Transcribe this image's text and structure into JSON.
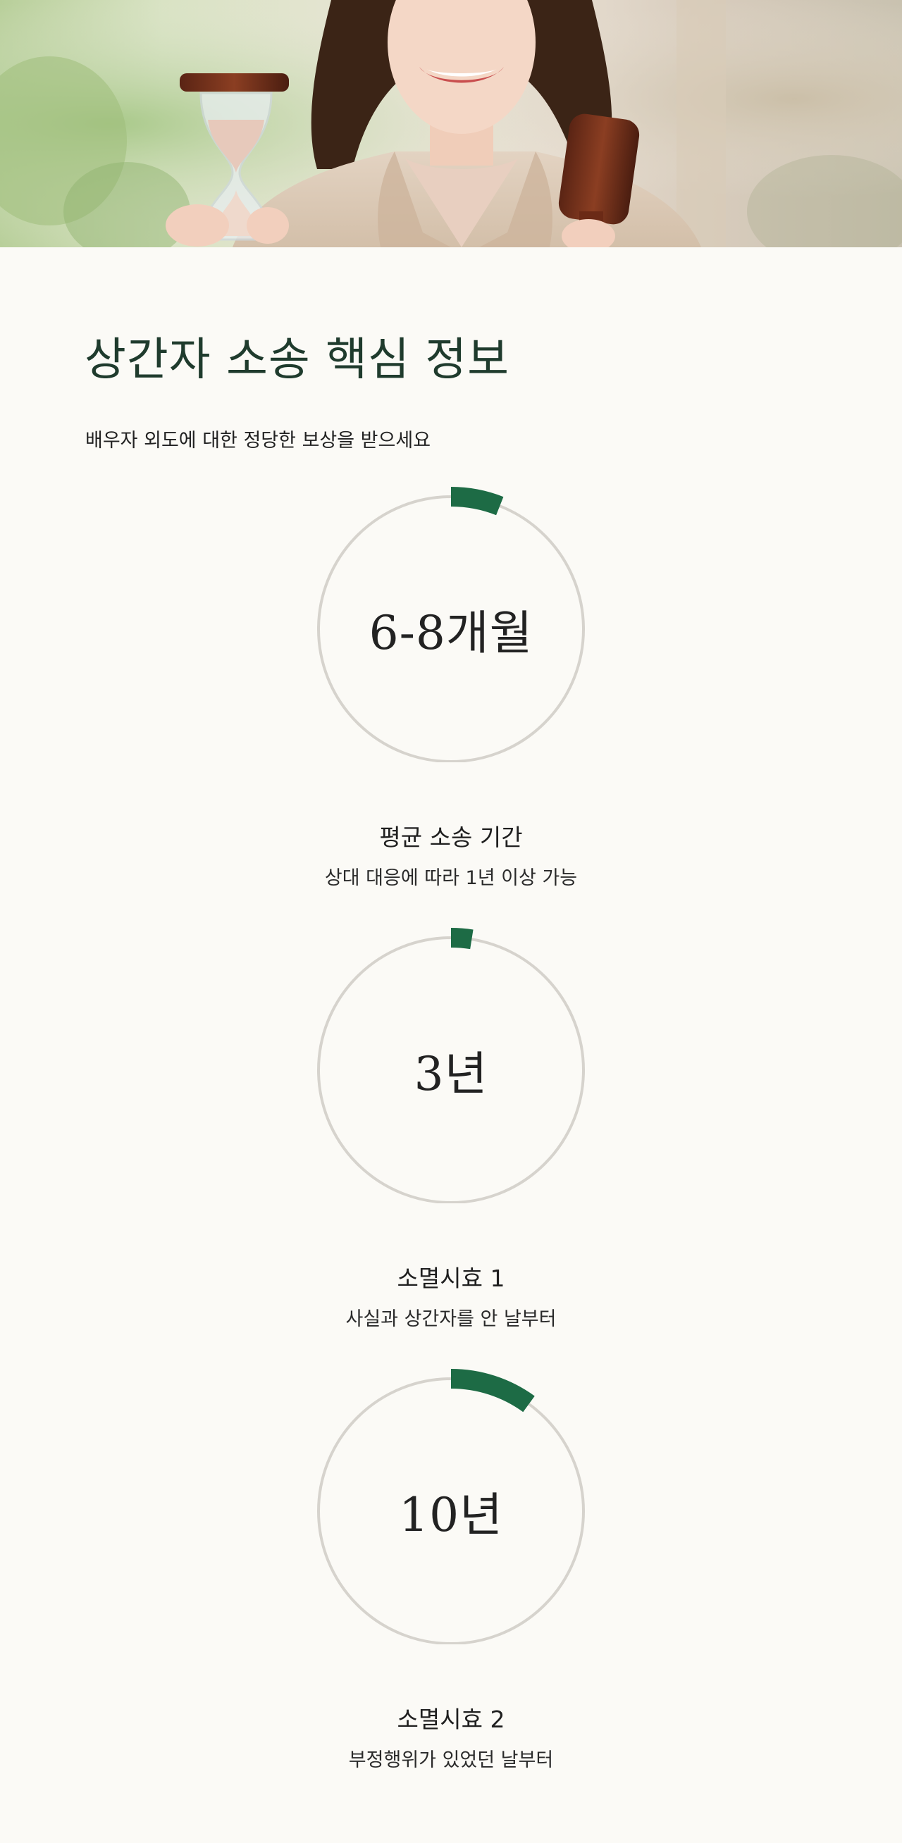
{
  "hero": {
    "image": "smiling-woman-with-hourglass-and-gavel"
  },
  "section": {
    "title": "상간자 소송 핵심 정보",
    "subtitle": "배우자 외도에 대한 정당한 보상을 받으세요"
  },
  "stats": [
    {
      "value": "6-8개월",
      "label": "평균 소송 기간",
      "description": "상대 대응에 따라 1년 이상 가능",
      "progress": 0.06
    },
    {
      "value": "3년",
      "label": "소멸시효 1",
      "description": "사실과 상간자를 안 날부터",
      "progress": 0.025
    },
    {
      "value": "10년",
      "label": "소멸시효 2",
      "description": "부정행위가 있었던 날부터",
      "progress": 0.1
    }
  ],
  "colors": {
    "accent": "#1d6b45",
    "ring_track": "#d6d3cd",
    "title": "#1f3b2d",
    "background": "#fbfaf6"
  }
}
